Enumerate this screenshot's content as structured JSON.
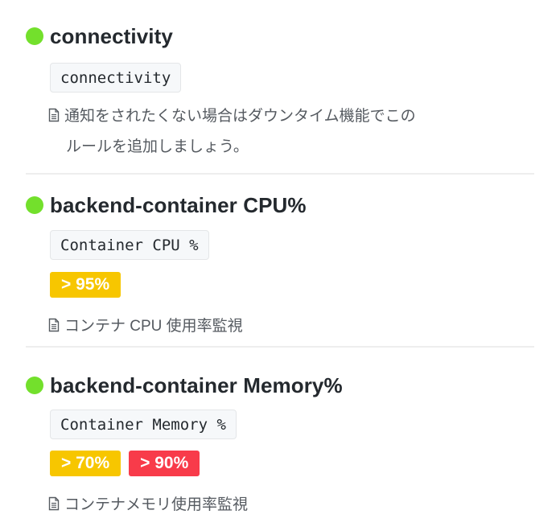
{
  "colors": {
    "status_ok": "#73e02c",
    "badge_warning": "#f7c600",
    "badge_critical": "#f83b4a",
    "code_bg": "#f6f8fa",
    "divider": "#eeeeee"
  },
  "rules": [
    {
      "title": "connectivity",
      "status": "ok",
      "status_icon": "green-dot",
      "metric": "connectivity",
      "thresholds": [],
      "description_icon": "document-icon",
      "description_line1": "通知をされたくない場合はダウンタイム機能でこの",
      "description_line2": "ルールを追加しましょう。"
    },
    {
      "title": "backend-container CPU%",
      "status": "ok",
      "status_icon": "green-dot",
      "metric": "Container CPU %",
      "thresholds": [
        {
          "label": "> 95%",
          "level": "warning"
        }
      ],
      "description_icon": "document-icon",
      "description_line1": "コンテナ CPU 使用率監視"
    },
    {
      "title": "backend-container Memory%",
      "status": "ok",
      "status_icon": "green-dot",
      "metric": "Container Memory %",
      "thresholds": [
        {
          "label": "> 70%",
          "level": "warning"
        },
        {
          "label": "> 90%",
          "level": "critical"
        }
      ],
      "description_icon": "document-icon",
      "description_line1": "コンテナメモリ使用率監視"
    }
  ]
}
